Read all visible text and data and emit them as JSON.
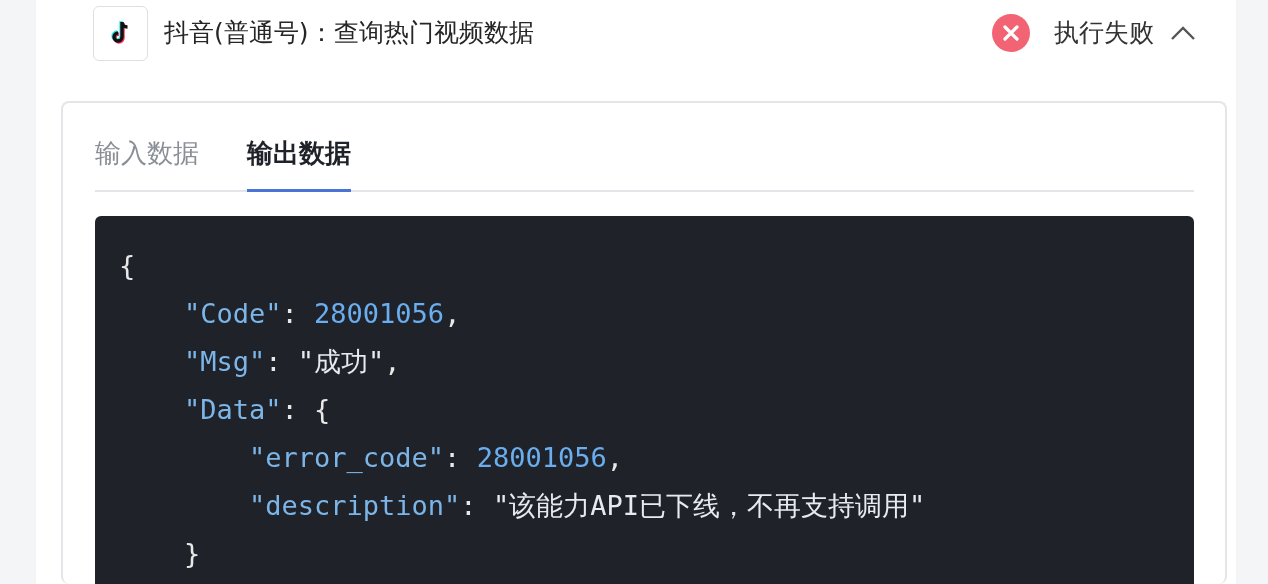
{
  "step": {
    "title": "抖音(普通号)：查询热门视频数据",
    "failed": true,
    "status_text": "执行失败",
    "expanded": true
  },
  "tabs": [
    {
      "label": "输入数据",
      "selected": false
    },
    {
      "label": "输出数据",
      "selected": true
    }
  ],
  "code_lines": [
    {
      "tokens": [
        {
          "kind": "punct",
          "text": "{"
        }
      ],
      "children": [
        {
          "tokens": [
            {
              "kind": "key",
              "text": "\"Code\""
            },
            {
              "kind": "punct",
              "text": ": "
            },
            {
              "kind": "number",
              "text": "28001056"
            },
            {
              "kind": "punct",
              "text": ","
            }
          ]
        },
        {
          "tokens": [
            {
              "kind": "key",
              "text": "\"Msg\""
            },
            {
              "kind": "punct",
              "text": ": "
            },
            {
              "kind": "string",
              "text": "\"成功\""
            },
            {
              "kind": "punct",
              "text": ","
            }
          ]
        },
        {
          "tokens": [
            {
              "kind": "key",
              "text": "\"Data\""
            },
            {
              "kind": "punct",
              "text": ": {"
            }
          ],
          "children": [
            {
              "tokens": [
                {
                  "kind": "key",
                  "text": "\"error_code\""
                },
                {
                  "kind": "punct",
                  "text": ": "
                },
                {
                  "kind": "number",
                  "text": "28001056"
                },
                {
                  "kind": "punct",
                  "text": ","
                }
              ]
            },
            {
              "tokens": [
                {
                  "kind": "key",
                  "text": "\"description\""
                },
                {
                  "kind": "punct",
                  "text": ": "
                },
                {
                  "kind": "string",
                  "text": "\"该能力API已下线，不再支持调用\""
                }
              ]
            }
          ]
        },
        {
          "tokens": [
            {
              "kind": "punct",
              "text": "}"
            }
          ]
        }
      ]
    }
  ]
}
